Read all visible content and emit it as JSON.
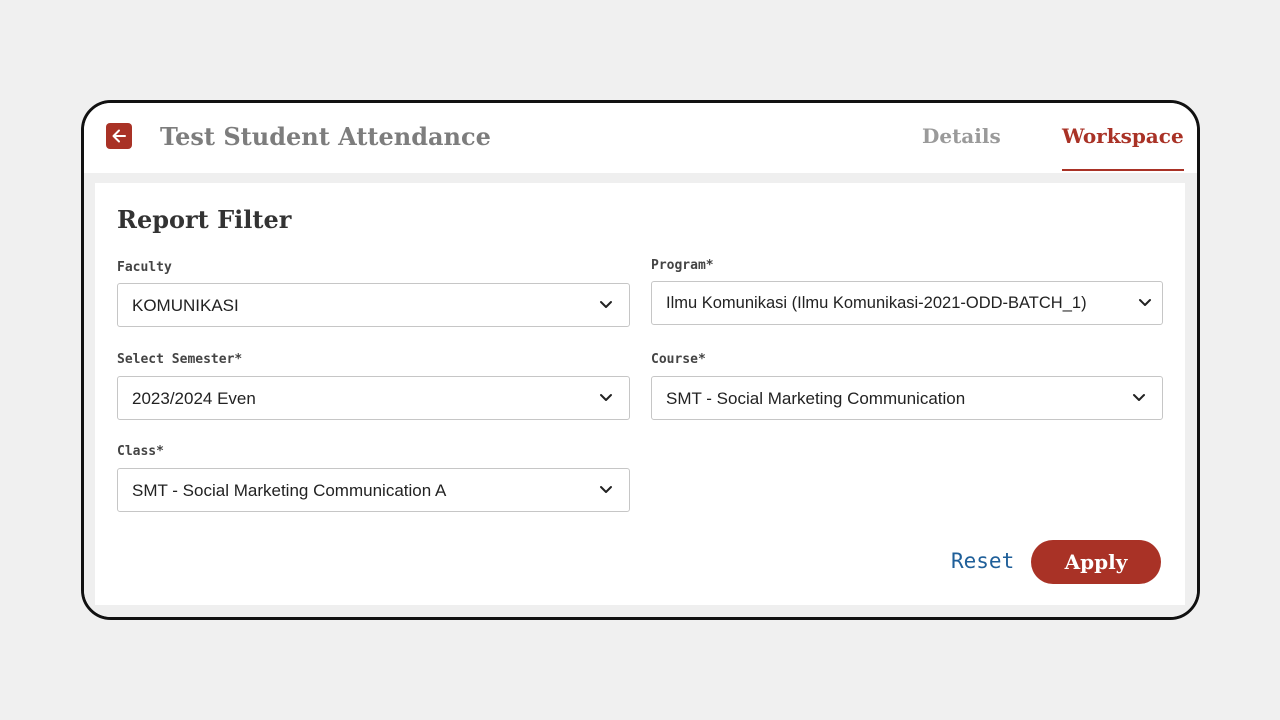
{
  "header": {
    "title": "Test Student Attendance",
    "tabs": [
      {
        "label": "Details",
        "active": false
      },
      {
        "label": "Workspace",
        "active": true
      }
    ]
  },
  "filter": {
    "title": "Report Filter",
    "faculty": {
      "label": "Faculty",
      "value": "KOMUNIKASI"
    },
    "program": {
      "label": "Program*",
      "value": "Ilmu Komunikasi (Ilmu Komunikasi-2021-ODD-BATCH_1)"
    },
    "semester": {
      "label": "Select Semester*",
      "value": "2023/2024 Even"
    },
    "course": {
      "label": "Course*",
      "value": "SMT - Social Marketing Communication"
    },
    "class": {
      "label": "Class*",
      "value": "SMT - Social Marketing Communication A"
    },
    "reset_label": "Reset",
    "apply_label": "Apply"
  },
  "colors": {
    "accent": "#a93226",
    "link": "#1f5f99",
    "background": "#f0f0f0"
  },
  "icons": {
    "back": "arrow-left-icon",
    "dropdown": "chevron-down-icon"
  }
}
